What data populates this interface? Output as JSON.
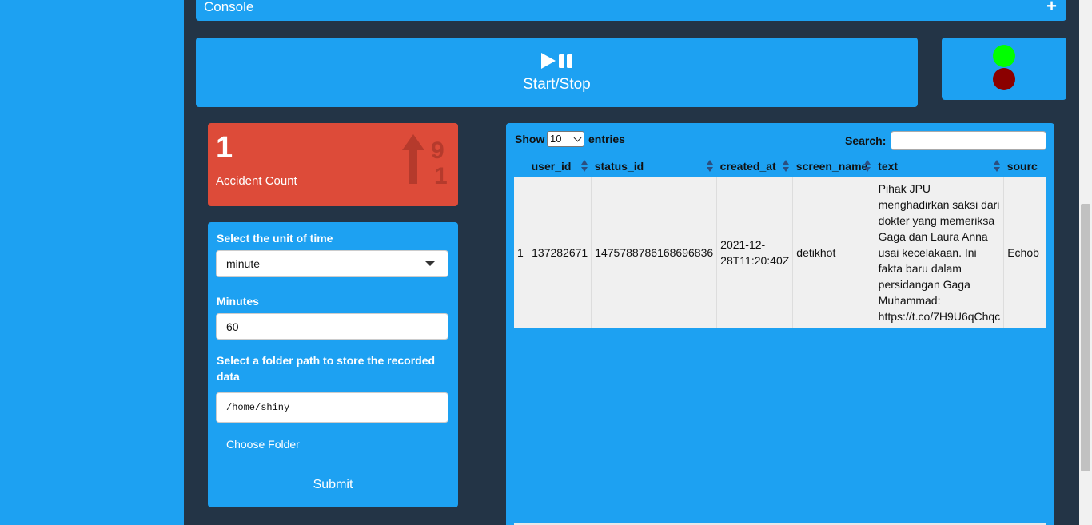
{
  "console": {
    "title": "Console",
    "expand_symbol": "+"
  },
  "controls": {
    "start_stop_label": "Start/Stop",
    "start_stop_icon": "play-pause-icon"
  },
  "status_lights": {
    "on_color": "#00ff00",
    "off_color": "#8b0000"
  },
  "accident_box": {
    "value": "1",
    "label": "Accident Count",
    "icon": "sort-numeric-up-icon",
    "color": "#dd4b39"
  },
  "form": {
    "unit_label": "Select the unit of time",
    "unit_value": "minute",
    "minutes_label": "Minutes",
    "minutes_value": "60",
    "folder_label": "Select a folder path to store the recorded data",
    "folder_value": "/home/shiny",
    "choose_folder_label": "Choose Folder",
    "submit_label": "Submit"
  },
  "table": {
    "show_label": "Show",
    "entries_value": "10",
    "entries_label": "entries",
    "search_label": "Search:",
    "columns": [
      "",
      "user_id",
      "status_id",
      "created_at",
      "screen_name",
      "text",
      "sourc"
    ],
    "rows": [
      [
        "1",
        "137282671",
        "1475788786168696836",
        "2021-12-28T11:20:40Z",
        "detikhot",
        "Pihak JPU menghadirkan saksi dari dokter yang memeriksa Gaga dan Laura Anna usai kecelakaan. Ini fakta baru dalam persidangan Gaga Muhammad: https://t.co/7H9U6qChqc",
        "Echob"
      ]
    ]
  },
  "theme": {
    "primary": "#1da1f2",
    "body_bg": "#233446"
  }
}
